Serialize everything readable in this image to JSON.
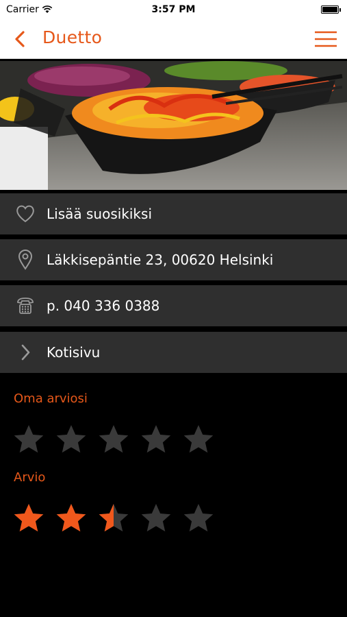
{
  "status_bar": {
    "carrier": "Carrier",
    "time": "3:57 PM"
  },
  "nav": {
    "title": "Duetto",
    "accent": "#e6581a"
  },
  "hero": {
    "alt_icon": "salad-image"
  },
  "rows": [
    {
      "label": "Lisää suosikiksi",
      "icon": "heart-icon"
    },
    {
      "label": "Läkkisepäntie 23, 00620 Helsinki",
      "icon": "location-pin-icon"
    },
    {
      "label": "p. 040 336 0388",
      "icon": "phone-icon"
    },
    {
      "label": "Kotisivu",
      "icon": "chevron-right-icon"
    }
  ],
  "own_rating": {
    "title": "Oma arviosi",
    "value": 0,
    "max": 5
  },
  "rating": {
    "title": "Arvio",
    "value": 2.5,
    "max": 5
  },
  "colors": {
    "row_bg": "#2f2f2f",
    "star_empty": "#3a3a3a",
    "star_filled": "#f0581c"
  }
}
